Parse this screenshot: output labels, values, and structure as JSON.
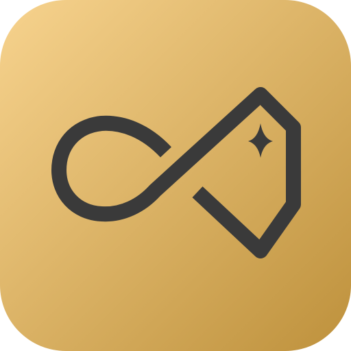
{
  "app_icon": {
    "name": "infinity-tag-logo",
    "colors": {
      "tile_gradient_start": "#F7D38E",
      "tile_gradient_end": "#BE913C",
      "glyph": "#3A3A3A"
    }
  }
}
